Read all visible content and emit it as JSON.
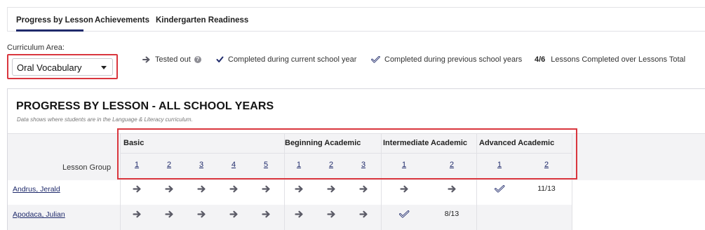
{
  "tabs": [
    {
      "label": "Progress by Lesson",
      "active": true
    },
    {
      "label": "Achievements",
      "active": false
    },
    {
      "label": "Kindergarten Readiness",
      "active": false
    }
  ],
  "filter": {
    "label": "Curriculum Area:",
    "selected": "Oral Vocabulary"
  },
  "legend": {
    "tested_out": "Tested out",
    "info_glyph": "?",
    "completed_current": "Completed during current school year",
    "completed_previous": "Completed during previous school years",
    "ratio_value": "4/6",
    "ratio_text": "Lessons Completed over Lessons Total"
  },
  "panel": {
    "title": "PROGRESS BY LESSON - ALL SCHOOL YEARS",
    "subtitle": "Data shows where students are in the Language & Literacy curriculum."
  },
  "grid": {
    "lesson_group_label": "Lesson Group",
    "groups": [
      {
        "name": "Basic",
        "lessons": [
          "1",
          "2",
          "3",
          "4",
          "5"
        ]
      },
      {
        "name": "Beginning Academic",
        "lessons": [
          "1",
          "2",
          "3"
        ]
      },
      {
        "name": "Intermediate Academic",
        "lessons": [
          "1",
          "2"
        ]
      },
      {
        "name": "Advanced Academic",
        "lessons": [
          "1",
          "2"
        ]
      }
    ],
    "students": [
      {
        "name": "Andrus, Jerald",
        "cells": [
          "arrow",
          "arrow",
          "arrow",
          "arrow",
          "arrow",
          "arrow",
          "arrow",
          "arrow",
          "arrow",
          "arrow",
          "check-prev",
          "11/13"
        ]
      },
      {
        "name": "Apodaca, Julian",
        "cells": [
          "arrow",
          "arrow",
          "arrow",
          "arrow",
          "arrow",
          "arrow",
          "arrow",
          "arrow",
          "check-prev",
          "8/13",
          "",
          ""
        ]
      }
    ]
  },
  "colors": {
    "accent": "#1f2a6b",
    "arrow": "#5a5a66",
    "highlight": "#d9363e"
  }
}
